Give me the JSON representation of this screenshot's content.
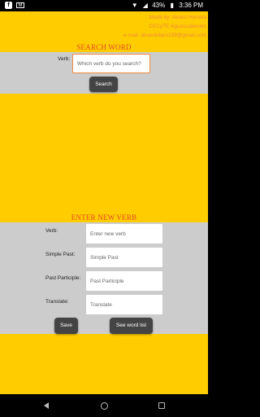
{
  "status_bar": {
    "notifications": [
      "facebook-icon",
      "gmail-icon"
    ],
    "battery": "43%",
    "time": "3:36 PM"
  },
  "credits": {
    "line1": "Made by: Alvaro Herrera",
    "line2": "CECyTE Aguascalientes",
    "line3": "e-mail: alvarokitaro199@gmail.com"
  },
  "search": {
    "title": "SEARCH WORD",
    "label": "Verb:",
    "placeholder": "Which verb do you search?",
    "button": "Search"
  },
  "new_verb": {
    "title": "ENTER NEW VERB",
    "fields": [
      {
        "label": "Verb:",
        "placeholder": "Enter new verb"
      },
      {
        "label": "Simple Past:",
        "placeholder": "Simple Past"
      },
      {
        "label": "Past Participle:",
        "placeholder": "Past Participle"
      },
      {
        "label": "Translate:",
        "placeholder": "Translate"
      }
    ],
    "save_button": "Save",
    "list_button": "See word list"
  },
  "colors": {
    "background": "#FFCC00",
    "panel": "#CCCCCC",
    "title": "#E34B2A",
    "accent": "#F08A3E",
    "button": "#444444"
  }
}
